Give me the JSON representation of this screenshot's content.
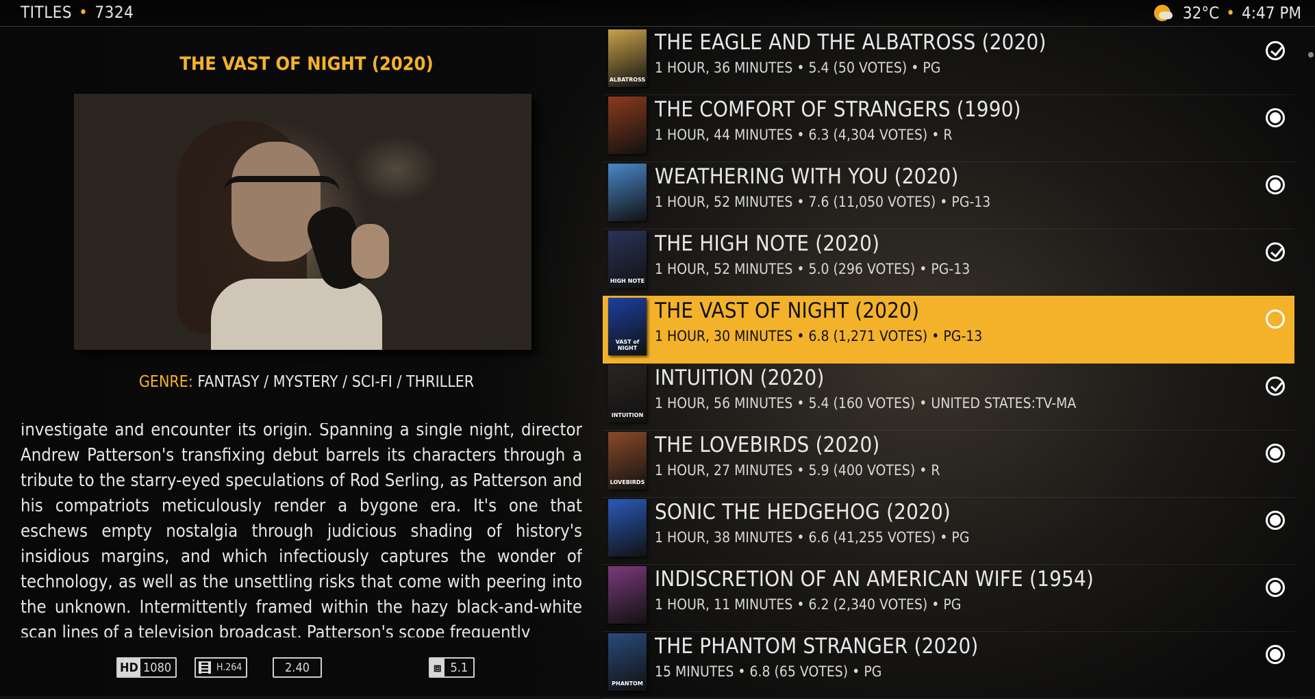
{
  "header": {
    "section": "TITLES",
    "separator": "•",
    "count": "7324",
    "temperature": "32°C",
    "time": "4:47 PM",
    "weather_icon": "partly-cloudy-icon"
  },
  "detail": {
    "title": "THE VAST OF NIGHT (2020)",
    "genre_label": "GENRE:",
    "genre_value": "FANTASY / MYSTERY / SCI-FI / THRILLER",
    "plot": "investigate and encounter its origin. Spanning a single night, director Andrew Patterson's transfixing debut barrels its characters through a tribute to the starry-eyed speculations of Rod Serling, as Patterson and his compatriots meticulously render a bygone era. It's one that eschews empty nostalgia through judicious shading of history's insidious margins, and which infectiously captures the wonder of technology, as well as the unsettling risks that come with peering into the unknown. Intermittently framed within the hazy black-and-white scan lines of a television broadcast, Patterson's scope frequently",
    "flags": {
      "hd": "HD",
      "resolution": "1080",
      "codec": "H.264",
      "aspect": "2.40",
      "audio": "5.1"
    }
  },
  "list": [
    {
      "title": "THE EAGLE AND THE ALBATROSS (2020)",
      "meta": "1 HOUR, 36 MINUTES • 5.4 (50 VOTES) • PG",
      "status": "watched",
      "poster_color": "#c9a24a",
      "poster_text": "ALBATROSS"
    },
    {
      "title": "THE COMFORT OF STRANGERS (1990)",
      "meta": "1 HOUR, 44 MINUTES • 6.3 (4,304 VOTES) • R",
      "status": "unwatched",
      "poster_color": "#8a3a1c",
      "poster_text": ""
    },
    {
      "title": "WEATHERING WITH YOU (2020)",
      "meta": "1 HOUR, 52 MINUTES • 7.6 (11,050 VOTES) • PG-13",
      "status": "unwatched",
      "poster_color": "#4a88c8",
      "poster_text": ""
    },
    {
      "title": "THE HIGH NOTE (2020)",
      "meta": "1 HOUR, 52 MINUTES • 5.0 (296 VOTES) • PG-13",
      "status": "watched",
      "poster_color": "#2a3358",
      "poster_text": "HIGH NOTE"
    },
    {
      "title": "THE VAST OF NIGHT (2020)",
      "meta": "1 HOUR, 30 MINUTES • 6.8 (1,271 VOTES) • PG-13",
      "status": "unwatched",
      "poster_color": "#1c3fa0",
      "poster_text": "VAST of NIGHT",
      "selected": true
    },
    {
      "title": "INTUITION (2020)",
      "meta": "1 HOUR, 56 MINUTES • 5.4 (160 VOTES) • UNITED STATES:TV-MA",
      "status": "watched",
      "poster_color": "#2a2522",
      "poster_text": "INTUITION"
    },
    {
      "title": "THE LOVEBIRDS (2020)",
      "meta": "1 HOUR, 27 MINUTES • 5.9 (400 VOTES) • R",
      "status": "unwatched",
      "poster_color": "#8a4a2a",
      "poster_text": "LOVEBIRDS"
    },
    {
      "title": "SONIC THE HEDGEHOG (2020)",
      "meta": "1 HOUR, 38 MINUTES • 6.6 (41,255 VOTES) • PG",
      "status": "unwatched",
      "poster_color": "#2a5ab8",
      "poster_text": ""
    },
    {
      "title": "INDISCRETION OF AN AMERICAN WIFE (1954)",
      "meta": "1 HOUR, 11 MINUTES • 6.2 (2,340 VOTES) • PG",
      "status": "unwatched",
      "poster_color": "#7a3a7a",
      "poster_text": ""
    },
    {
      "title": "THE PHANTOM STRANGER (2020)",
      "meta": "15 MINUTES • 6.8 (65 VOTES) • PG",
      "status": "unwatched",
      "poster_color": "#2a4a7a",
      "poster_text": "PHANTOM"
    }
  ],
  "colors": {
    "accent": "#f4b22a",
    "background": "#111111"
  }
}
